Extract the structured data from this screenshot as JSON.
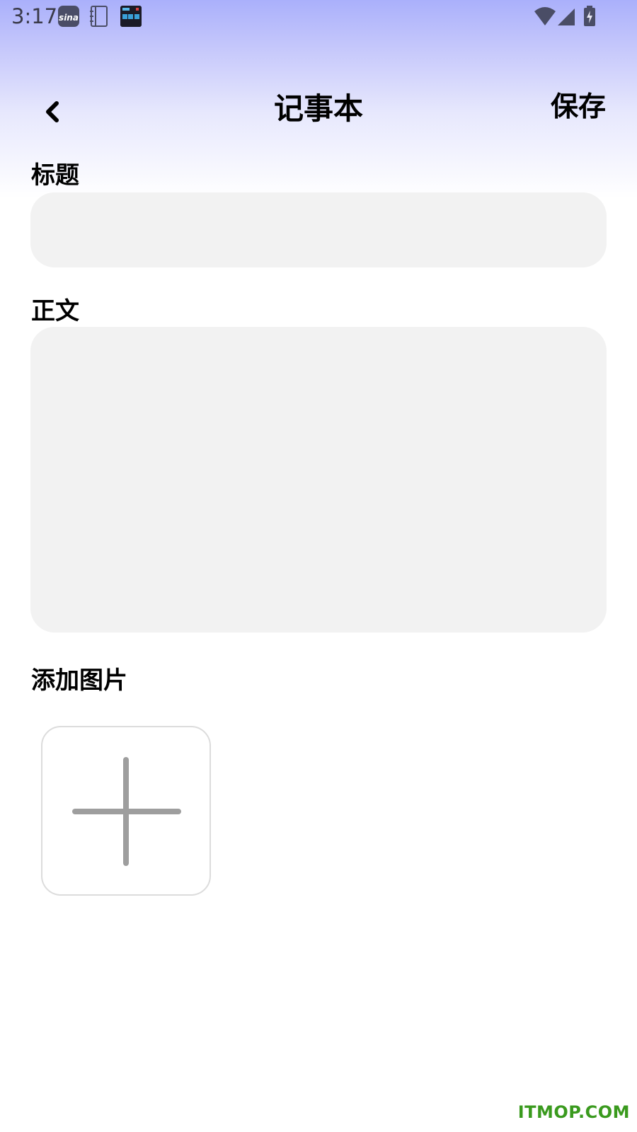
{
  "status_bar": {
    "time": "3:17",
    "icons": [
      "sina-icon",
      "notebook-icon",
      "clock-app-icon",
      "wifi-icon",
      "signal-icon",
      "battery-charging-icon"
    ]
  },
  "header": {
    "back_icon": "chevron-left-icon",
    "title": "记事本",
    "save_label": "保存"
  },
  "form": {
    "title_label": "标题",
    "title_value": "",
    "title_placeholder": "",
    "body_label": "正文",
    "body_value": "",
    "body_placeholder": "",
    "image_label": "添加图片",
    "add_image_icon": "plus-icon"
  },
  "watermark": {
    "text": "ITMOP.COM"
  },
  "colors": {
    "gradient_top": "#aab0fb",
    "input_background": "#f2f2f2",
    "watermark_green": "#3a9a1e"
  }
}
